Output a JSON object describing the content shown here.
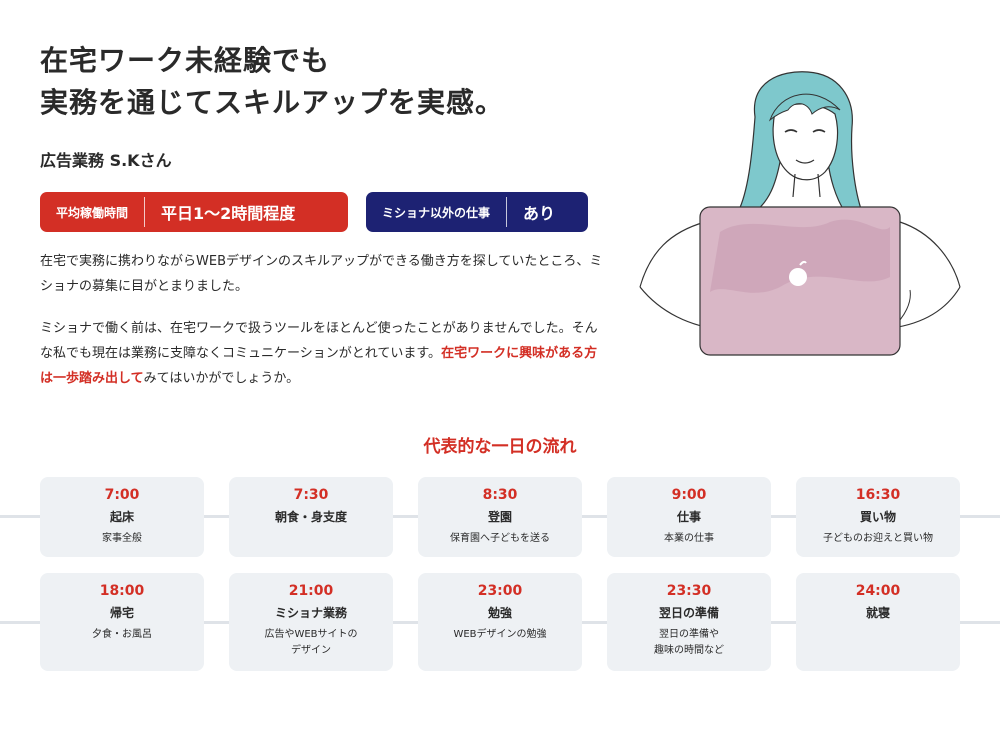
{
  "headline": {
    "line1": "在宅ワーク未経験でも",
    "line2": "実務を通じてスキルアップを実感。"
  },
  "person": "広告業務 S.Kさん",
  "badges": [
    {
      "key": "平均稼働時間",
      "value": "平日1～2時間程度",
      "color": "#d32f25"
    },
    {
      "key": "ミショナ以外の仕事",
      "value": "あり",
      "color": "#1d2273"
    }
  ],
  "paragraph1": "在宅で実務に携わりながらWEBデザインのスキルアップができる働き方を探していたところ、ミショナの募集に目がとまりました。",
  "paragraph2": {
    "before": "ミショナで働く前は、在宅ワークで扱うツールをほとんど使ったことがありませんでした。そんな私でも現在は業務に支障なくコミュニケーションがとれています。",
    "highlight": "在宅ワークに興味がある方は一歩踏み出して",
    "after": "みてはいかがでしょうか。"
  },
  "schedule": {
    "title": "代表的な一日の流れ",
    "items": [
      {
        "time": "7:00",
        "activity": "起床",
        "note": "家事全般"
      },
      {
        "time": "7:30",
        "activity": "朝食・身支度",
        "note": ""
      },
      {
        "time": "8:30",
        "activity": "登園",
        "note": "保育園へ子どもを送る"
      },
      {
        "time": "9:00",
        "activity": "仕事",
        "note": "本業の仕事"
      },
      {
        "time": "16:30",
        "activity": "買い物",
        "note": "子どものお迎えと買い物"
      },
      {
        "time": "18:00",
        "activity": "帰宅",
        "note": "夕食・お風呂"
      },
      {
        "time": "21:00",
        "activity": "ミショナ業務",
        "note": "広告やWEBサイトの\nデザイン"
      },
      {
        "time": "23:00",
        "activity": "勉強",
        "note": "WEBデザインの勉強"
      },
      {
        "time": "23:30",
        "activity": "翌日の準備",
        "note": "翌日の準備や\n趣味の時間など"
      },
      {
        "time": "24:00",
        "activity": "就寝",
        "note": ""
      }
    ]
  },
  "colors": {
    "accent_red": "#d32f25",
    "navy": "#1d2273",
    "card_bg": "#eef1f4",
    "hair": "#7ec8cc",
    "laptop": "#d9b7c6"
  }
}
